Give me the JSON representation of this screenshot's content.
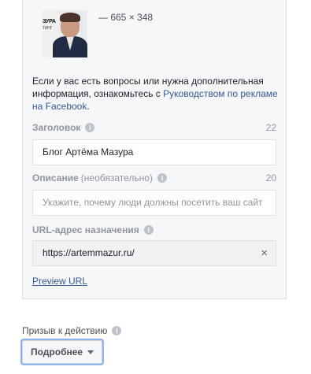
{
  "preview": {
    "image_dims": "— 665 × 348",
    "thumb_logo_line1": "ЗУРА",
    "thumb_logo_line2": "ТИНГ"
  },
  "help": {
    "text_before": "Если у вас есть вопросы или нужна дополнительная информация, ознакомьтесь с ",
    "link": "Руководством по рекламе на Facebook",
    "text_after": "."
  },
  "headline": {
    "label": "Заголовок",
    "counter": "22",
    "value": "Блог Артёма Мазура"
  },
  "description": {
    "label": "Описание",
    "optional": "(необязательно)",
    "counter": "20",
    "placeholder": "Укажите, почему люди должны посетить ваш сайт"
  },
  "url": {
    "label": "URL-адрес назначения",
    "value": "https://artemmazur.ru/",
    "clear": "×"
  },
  "preview_url": "Preview URL",
  "cta": {
    "label": "Призыв к действию",
    "button": "Подробнее"
  },
  "icons": {
    "info": "i"
  }
}
